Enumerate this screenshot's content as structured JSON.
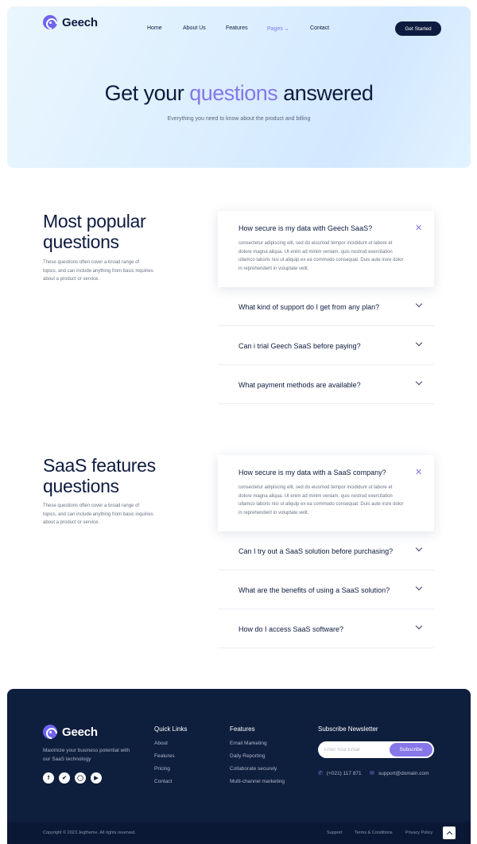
{
  "brand": {
    "name": "Geech"
  },
  "nav": {
    "items": [
      "Home",
      "About Us",
      "Features",
      "Pages",
      "Contact"
    ],
    "active": "Pages",
    "cta": "Get Started"
  },
  "hero": {
    "title_pre": "Get your ",
    "title_highlight": "questions",
    "title_post": " answered",
    "subtitle": "Everything you need to know about the product and billing"
  },
  "sections": [
    {
      "title": "Most popular questions",
      "description": "These questions often cover a broad range of topics, and can include anything from basic inquiries about a product or service.",
      "open": {
        "question": "How secure is my data with Geech SaaS?",
        "answer": "consectetur adipiscing elit, sed do eiusmod tempor incididunt ut labore et dolore magna aliqua. Ut enim ad minim veniam, quis nostrud exercitation ullamco laboris nisi ut aliquip ex ea commodo consequat. Duis aute irure dolor in reprehenderit in voluptate velit."
      },
      "collapsed": [
        "What kind of support do I get from any plan?",
        "Can i trial Geech SaaS before paying?",
        "What payment methods are available?"
      ]
    },
    {
      "title": "SaaS features questions",
      "description": "These questions often cover a broad range of topics, and can include anything from basic inquiries about a product or service.",
      "open": {
        "question": "How secure is my data with a SaaS company?",
        "answer": "consectetur adipiscing elit, sed do eiusmod tempor incididunt ut labore et dolore magna aliqua. Ut enim ad minim veniam, quis nostrud exercitation ullamco laboris nisi ut aliquip ex ea commodo consequat. Duis aute irure dolor in reprehenderit in voluptate velit."
      },
      "collapsed": [
        "Can I try out a SaaS solution before purchasing?",
        "What are the benefits of using a SaaS solution?",
        "How do I access SaaS software?"
      ]
    }
  ],
  "footer": {
    "tagline": "Maximize your business potential with our SaaS technology",
    "socials": [
      "facebook-icon",
      "twitter-icon",
      "instagram-icon",
      "youtube-icon"
    ],
    "quick_links": {
      "heading": "Quick Links",
      "items": [
        "About",
        "Features",
        "Pricing",
        "Contact"
      ]
    },
    "features": {
      "heading": "Features",
      "items": [
        "Email Marketing",
        "Daily Reporting",
        "Collaborate securely",
        "Multi-channel marketing"
      ]
    },
    "newsletter": {
      "heading": "Subscribe Newsletter",
      "placeholder": "Enter Your Email",
      "button": "Subscribe",
      "phone": "(+021) 117 871",
      "email": "support@domain.com"
    },
    "copyright": "Copyright © 2023 Jegtheme. All rights reserved.",
    "bottom_links": [
      "Support",
      "Terms & Conditions",
      "Privacy Policy"
    ]
  },
  "colors": {
    "navy": "#0d1b3e",
    "accent": "#8577e8",
    "footer_bg": "#0e1e3d",
    "hero_bg": "#dcefff"
  }
}
